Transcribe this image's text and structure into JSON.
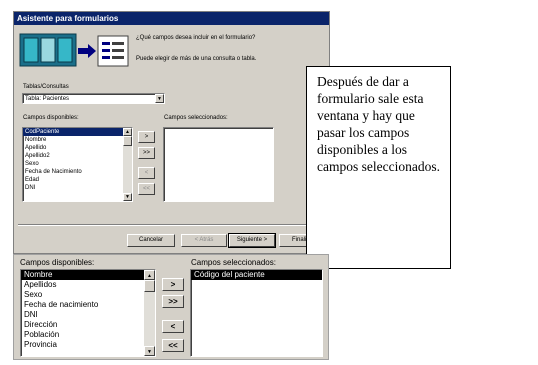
{
  "wizard": {
    "title": "Asistente para formularios",
    "question": "¿Qué campos desea incluir en el formulario?",
    "hint": "Puede elegir de más de una consulta o tabla.",
    "tables_label": "Tablas/Consultas",
    "table_value": "Tabla: Pacientes",
    "available_label": "Campos disponibles:",
    "selected_label": "Campos seleccionados:",
    "available_items": [
      "CodPaciente",
      "Nombre",
      "Apellido",
      "Apellido2",
      "Sexo",
      "Fecha de Nacimiento",
      "Edad",
      "DNI"
    ],
    "move_buttons": [
      ">",
      ">>",
      "<",
      "<<"
    ],
    "footer_buttons": {
      "cancel": "Cancelar",
      "back": "< Atrás",
      "next": "Siguiente >",
      "finish": "Finali"
    }
  },
  "note": {
    "text": "Después de dar a formulario sale esta ventana y hay que pasar los campos disponibles a los campos seleccionados."
  },
  "panel": {
    "available_label": "Campos disponibles:",
    "selected_label": "Campos seleccionados:",
    "available_items": [
      "Nombre",
      "Apellidos",
      "Sexo",
      "Fecha de nacimiento",
      "DNI",
      "Dirección",
      "Población",
      "Provincia"
    ],
    "selected_items": [
      "Código del paciente"
    ],
    "move_buttons": [
      ">",
      ">>",
      "<",
      "<<"
    ]
  }
}
